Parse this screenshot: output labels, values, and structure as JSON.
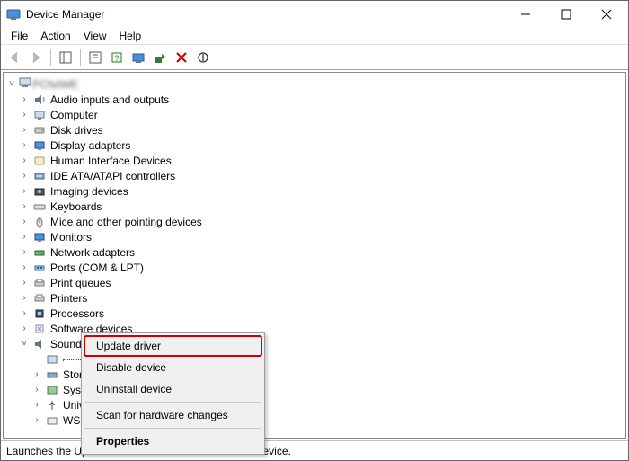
{
  "window": {
    "title": "Device Manager"
  },
  "menu": {
    "file": "File",
    "action": "Action",
    "view": "View",
    "help": "Help"
  },
  "root_label": "PCNAME",
  "nodes": [
    {
      "icon": "audio",
      "label": "Audio inputs and outputs",
      "expander": ">"
    },
    {
      "icon": "computer",
      "label": "Computer",
      "expander": ">"
    },
    {
      "icon": "disk",
      "label": "Disk drives",
      "expander": ">"
    },
    {
      "icon": "display",
      "label": "Display adapters",
      "expander": ">"
    },
    {
      "icon": "hid",
      "label": "Human Interface Devices",
      "expander": ">"
    },
    {
      "icon": "ide",
      "label": "IDE ATA/ATAPI controllers",
      "expander": ">"
    },
    {
      "icon": "imaging",
      "label": "Imaging devices",
      "expander": ">"
    },
    {
      "icon": "keyboard",
      "label": "Keyboards",
      "expander": ">"
    },
    {
      "icon": "mouse",
      "label": "Mice and other pointing devices",
      "expander": ">"
    },
    {
      "icon": "monitor",
      "label": "Monitors",
      "expander": ">"
    },
    {
      "icon": "network",
      "label": "Network adapters",
      "expander": ">"
    },
    {
      "icon": "port",
      "label": "Ports (COM & LPT)",
      "expander": ">"
    },
    {
      "icon": "printq",
      "label": "Print queues",
      "expander": ">"
    },
    {
      "icon": "printer",
      "label": "Printers",
      "expander": ">"
    },
    {
      "icon": "cpu",
      "label": "Processors",
      "expander": ">"
    },
    {
      "icon": "software",
      "label": "Software devices",
      "expander": ">"
    }
  ],
  "sound_node": {
    "label": "Sound, video and game controllers",
    "expander": "v"
  },
  "sound_children": [
    {
      "label": " "
    },
    {
      "label": "Stor"
    },
    {
      "label": "Syst"
    },
    {
      "label": "Univ"
    },
    {
      "label": "WSD"
    }
  ],
  "context_menu": {
    "update": "Update driver",
    "disable": "Disable device",
    "uninstall": "Uninstall device",
    "scan": "Scan for hardware changes",
    "properties": "Properties"
  },
  "status": "Launches the Update Driver Wizard for the selected device."
}
